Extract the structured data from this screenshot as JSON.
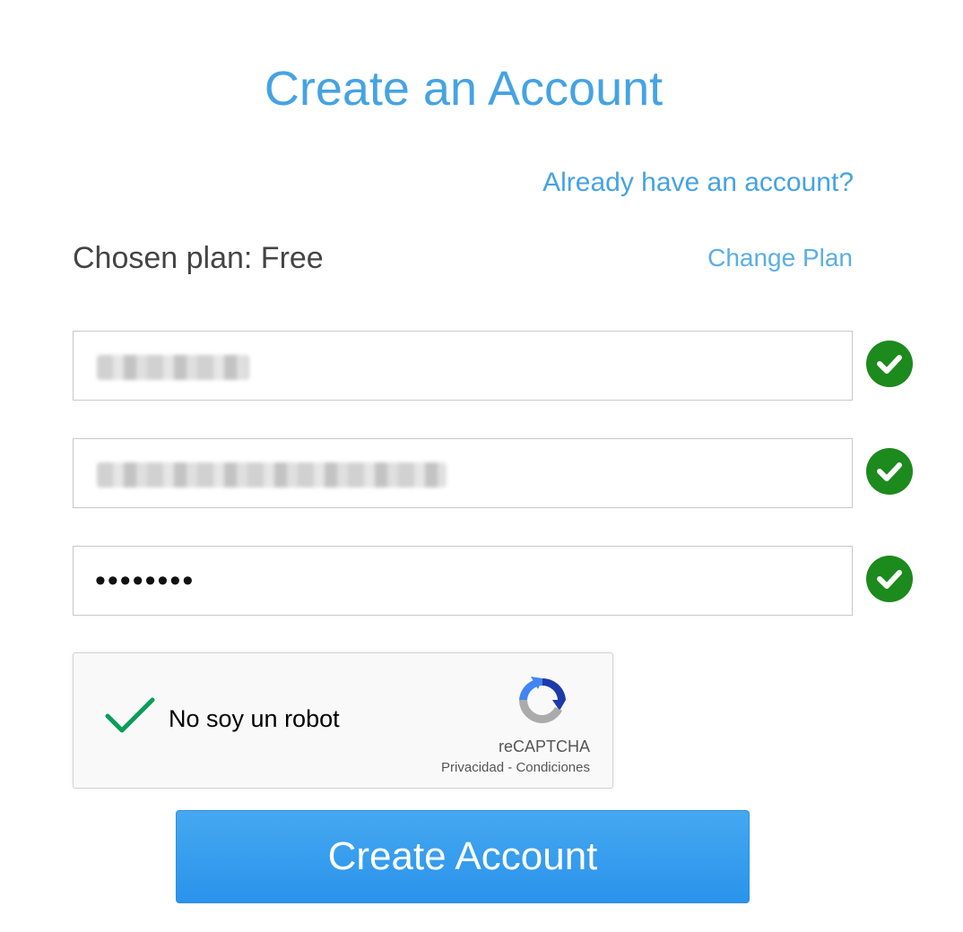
{
  "page": {
    "title": "Create an Account",
    "login_link": "Already have an account?"
  },
  "plan": {
    "label": "Chosen plan: Free",
    "change_link": "Change Plan"
  },
  "fields": {
    "name": {
      "value": "",
      "status_icon": "check-circle-icon"
    },
    "email": {
      "value": "",
      "status_icon": "check-circle-icon"
    },
    "password": {
      "value": "••••••••",
      "status_icon": "check-circle-icon"
    }
  },
  "recaptcha": {
    "label": "No soy un robot",
    "checked": true,
    "brand": "reCAPTCHA",
    "privacy": "Privacidad",
    "separator": " - ",
    "terms": "Condiciones"
  },
  "submit": {
    "label": "Create Account"
  },
  "colors": {
    "accent": "#45a3e3",
    "success": "#1c8a1c",
    "button": "#2a93eb"
  }
}
